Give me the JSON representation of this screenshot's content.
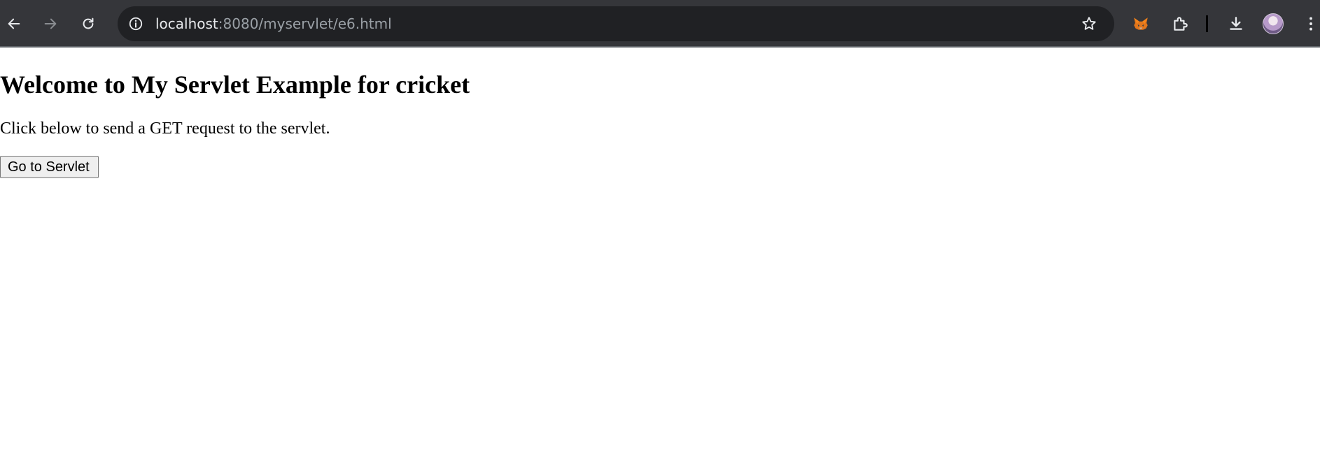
{
  "browser": {
    "url": {
      "host": "localhost",
      "rest": ":8080/myservlet/e6.html"
    },
    "toolbar_icons": {
      "back": "arrow-left-icon",
      "forward": "arrow-right-icon",
      "reload": "reload-icon",
      "site_info": "info-icon",
      "bookmark": "star-icon",
      "metamask": "fox-icon",
      "extensions": "puzzle-icon",
      "downloads": "download-icon",
      "menu": "kebab-menu-icon"
    },
    "colors": {
      "toolbar_bg": "#35363a",
      "omnibox_bg": "#202124",
      "url_host": "#e8eaed",
      "url_rest": "#9aa0a6"
    }
  },
  "page": {
    "title": "Welcome to My Servlet Example for cricket",
    "text": "Click below to send a GET request to the servlet.",
    "button_label": "Go to Servlet"
  }
}
